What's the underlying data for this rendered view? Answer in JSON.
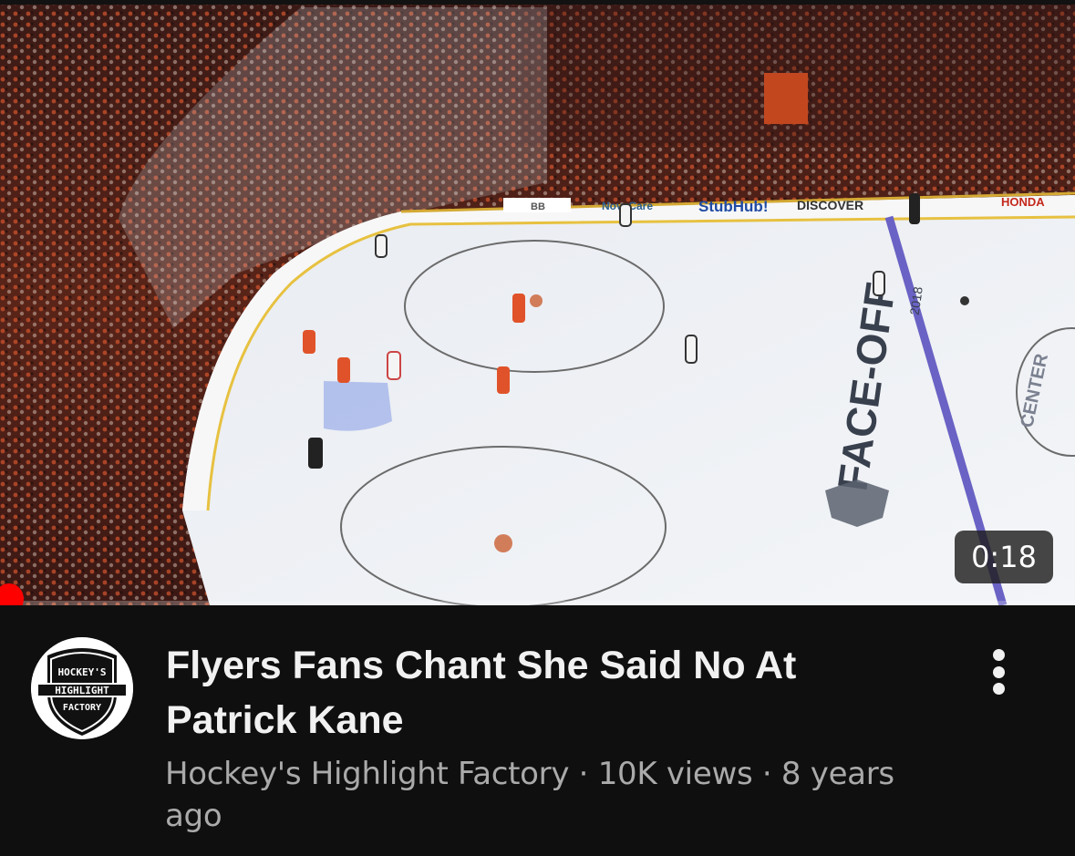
{
  "video": {
    "duration": "0:18",
    "progress_fraction": 0.0,
    "title": "Flyers Fans Chant She Said No At Patrick Kane",
    "channel": "Hockey's Highlight Factory",
    "views": "10K views",
    "age": "8 years ago",
    "separator": " · "
  },
  "thumbnail": {
    "boards_ads": [
      "BB",
      "NovaCare",
      "StubHub!",
      "DISCOVER",
      "HONDA"
    ],
    "ice_text": "FACE-OFF",
    "ice_year": "2018",
    "circle_text": "CENTER"
  },
  "avatar": {
    "lines": [
      "HOCKEY'S",
      "HIGHLIGHT",
      "FACTORY"
    ]
  },
  "colors": {
    "background": "#0f0f0f",
    "title": "#f1f1f1",
    "meta": "#aaaaaa",
    "progress": "#ff0000",
    "badge_bg": "#1e1e1e",
    "blue_line": "#6a62c4"
  },
  "icons": {
    "more": "vertical-ellipsis-icon"
  }
}
